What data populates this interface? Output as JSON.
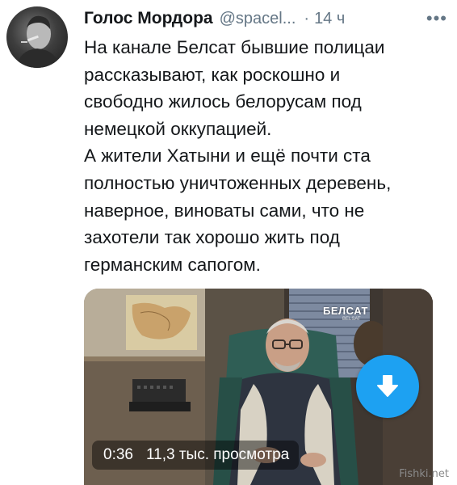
{
  "tweet": {
    "author_name": "Голос Мордора",
    "handle": "@spacel...",
    "separator": "·",
    "time": "14 ч",
    "more_icon": "more-dots-icon",
    "text_lines": [
      "На канале Белсат бывшие полицаи",
      "рассказывают, как роскошно и",
      "свободно жилось белорусам под",
      "немецкой оккупацией.",
      "А жители Хатыни и ещё почти ста",
      "полностью уничтоженных деревень,",
      "наверное, виноваты сами, что не",
      "захотели так хорошо жить под",
      "германским сапогом."
    ]
  },
  "media": {
    "channel_logo": "БЕЛСАТ",
    "channel_logo_sub": "BELSAT",
    "duration": "0:36",
    "views": "11,3 тыс. просмотра",
    "download_icon": "download-arrow-icon",
    "download_button_color": "#1da1f2"
  },
  "watermark": "Fishki.net"
}
